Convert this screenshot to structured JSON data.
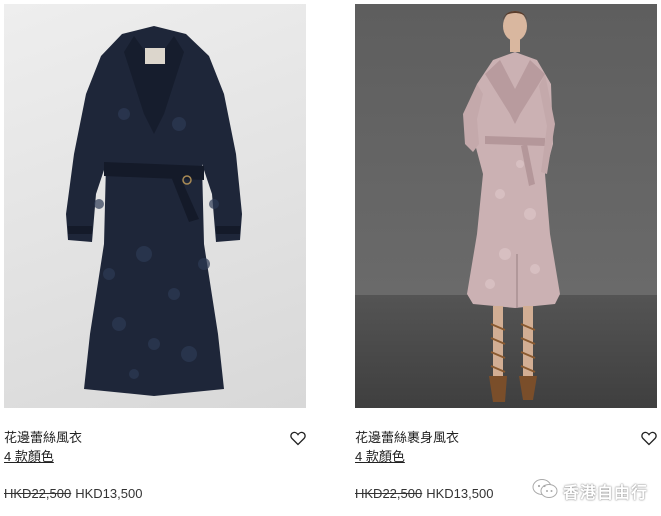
{
  "products": [
    {
      "title": "花邊蕾絲風衣",
      "colors_link": "4 款顏色",
      "original_price": "HKD22,500",
      "sale_price": "HKD13,500"
    },
    {
      "title": "花邊蕾絲裹身風衣",
      "colors_link": "4 款顏色",
      "original_price": "HKD22,500",
      "sale_price": "HKD13,500"
    }
  ],
  "watermark": {
    "text": "香港自由行",
    "icon": "wechat-icon"
  },
  "colors": {
    "navy_coat": "#1e2639",
    "pink_coat": "#cbb1b3"
  }
}
